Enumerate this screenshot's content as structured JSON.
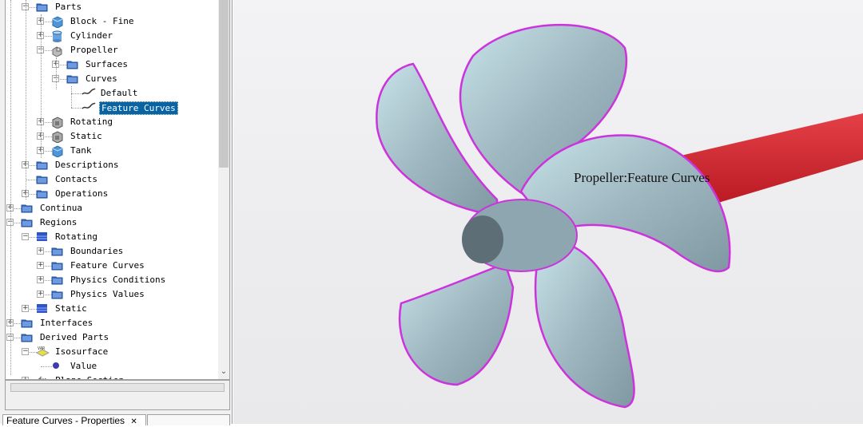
{
  "tree": [
    {
      "label": "Parts",
      "level": 1,
      "expander": "minus",
      "icon": "folder-icon"
    },
    {
      "label": "Block - Fine",
      "level": 2,
      "expander": "plus",
      "icon": "block-part-icon"
    },
    {
      "label": "Cylinder",
      "level": 2,
      "expander": "plus",
      "icon": "cylinder-part-icon"
    },
    {
      "label": "Propeller",
      "level": 2,
      "expander": "minus",
      "icon": "cad-part-icon"
    },
    {
      "label": "Surfaces",
      "level": 3,
      "expander": "plus",
      "icon": "folder-icon"
    },
    {
      "label": "Curves",
      "level": 3,
      "expander": "minus",
      "icon": "folder-icon"
    },
    {
      "label": "Default",
      "level": 4,
      "expander": "none",
      "icon": "curve-icon"
    },
    {
      "label": "Feature Curves",
      "level": 4,
      "expander": "none",
      "icon": "curve-icon",
      "selected": true
    },
    {
      "label": "Rotating",
      "level": 2,
      "expander": "plus",
      "icon": "mesh-part-icon"
    },
    {
      "label": "Static",
      "level": 2,
      "expander": "plus",
      "icon": "mesh-part-icon"
    },
    {
      "label": "Tank",
      "level": 2,
      "expander": "plus",
      "icon": "block-part-icon"
    },
    {
      "label": "Descriptions",
      "level": 1,
      "expander": "plus",
      "icon": "folder-icon"
    },
    {
      "label": "Contacts",
      "level": 1,
      "expander": "none",
      "icon": "folder-icon"
    },
    {
      "label": "Operations",
      "level": 1,
      "expander": "plus",
      "icon": "folder-icon"
    },
    {
      "label": "Continua",
      "level": 0,
      "expander": "plus",
      "icon": "folder-icon"
    },
    {
      "label": "Regions",
      "level": 0,
      "expander": "minus",
      "icon": "folder-icon"
    },
    {
      "label": "Rotating",
      "level": 1,
      "expander": "minus",
      "icon": "region-icon"
    },
    {
      "label": "Boundaries",
      "level": 2,
      "expander": "plus",
      "icon": "folder-icon"
    },
    {
      "label": "Feature Curves",
      "level": 2,
      "expander": "plus",
      "icon": "folder-icon"
    },
    {
      "label": "Physics Conditions",
      "level": 2,
      "expander": "plus",
      "icon": "folder-icon"
    },
    {
      "label": "Physics Values",
      "level": 2,
      "expander": "plus",
      "icon": "folder-icon"
    },
    {
      "label": "Static",
      "level": 1,
      "expander": "plus",
      "icon": "region-icon"
    },
    {
      "label": "Interfaces",
      "level": 0,
      "expander": "plus",
      "icon": "folder-icon"
    },
    {
      "label": "Derived Parts",
      "level": 0,
      "expander": "minus",
      "icon": "folder-icon"
    },
    {
      "label": "Isosurface",
      "level": 1,
      "expander": "minus",
      "icon": "isosurface-icon",
      "badge": "VAR"
    },
    {
      "label": "Value",
      "level": 2,
      "expander": "none",
      "icon": "value-dot-icon"
    },
    {
      "label": "Plane Section",
      "level": 1,
      "expander": "plus",
      "icon": "function-icon",
      "badge": "fx"
    }
  ],
  "properties_tab": {
    "label": "Feature Curves - Properties",
    "close": "✕"
  },
  "viewport": {
    "label": "Propeller:Feature Curves",
    "colors": {
      "blade": "#9fb7c0",
      "outline": "#cc33dd",
      "shaft": "#d8262e",
      "selection": "#0a64a4"
    }
  }
}
